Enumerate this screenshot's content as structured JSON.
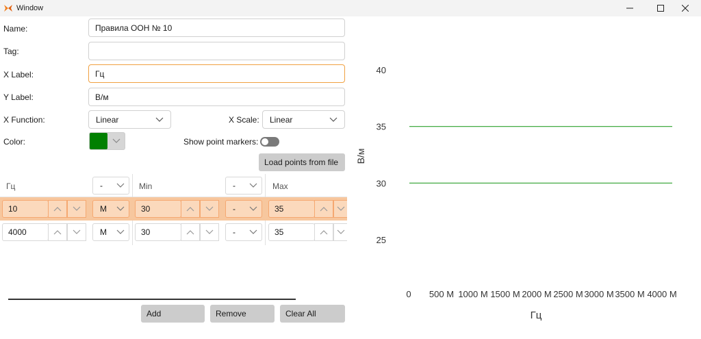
{
  "window": {
    "title": "Window"
  },
  "form": {
    "name_label": "Name:",
    "name_value": "Правила ООН № 10",
    "tag_label": "Tag:",
    "tag_value": "",
    "xlabel_label": "X Label:",
    "xlabel_value": "Гц",
    "ylabel_label": "Y Label:",
    "ylabel_value": "В/м",
    "xfunction_label": "X Function:",
    "xfunction_value": "Linear",
    "xscale_label": "X Scale:",
    "xscale_value": "Linear",
    "color_label": "Color:",
    "color_value": "#008000",
    "show_markers_label": "Show point markers:",
    "show_markers_on": false,
    "load_button": "Load points from file"
  },
  "grid": {
    "headers": [
      {
        "label": "Гц",
        "unit": "-"
      },
      {
        "label": "Min",
        "unit": "-"
      },
      {
        "label": "Max",
        "unit": ""
      }
    ],
    "rows": [
      {
        "freq": "10",
        "freq_unit": "M",
        "min": "30",
        "min_unit": "-",
        "max": "35",
        "selected": true
      },
      {
        "freq": "4000",
        "freq_unit": "M",
        "min": "30",
        "min_unit": "-",
        "max": "35",
        "selected": false
      }
    ]
  },
  "buttons": {
    "add": "Add",
    "remove": "Remove",
    "clear_all": "Clear All"
  },
  "chart_data": {
    "type": "line",
    "xlabel": "Гц",
    "ylabel": "В/м",
    "xlim": [
      0,
      4000
    ],
    "ylim": [
      22.5,
      41
    ],
    "x_ticks": [
      "0",
      "500 M",
      "1000 M",
      "1500 M",
      "2000 M",
      "2500 M",
      "3000 M",
      "3500 M",
      "4000 M"
    ],
    "x_tick_values": [
      0,
      500,
      1000,
      1500,
      2000,
      2500,
      3000,
      3500,
      4000
    ],
    "y_ticks": [
      "40",
      "35",
      "30",
      "25"
    ],
    "y_tick_values": [
      40,
      35,
      30,
      25
    ],
    "series": [
      {
        "x": [
          10,
          4000
        ],
        "y": [
          35,
          35
        ],
        "color": "#2ca02c"
      },
      {
        "x": [
          10,
          4000
        ],
        "y": [
          30,
          30
        ],
        "color": "#2ca02c"
      }
    ],
    "grid": false
  }
}
